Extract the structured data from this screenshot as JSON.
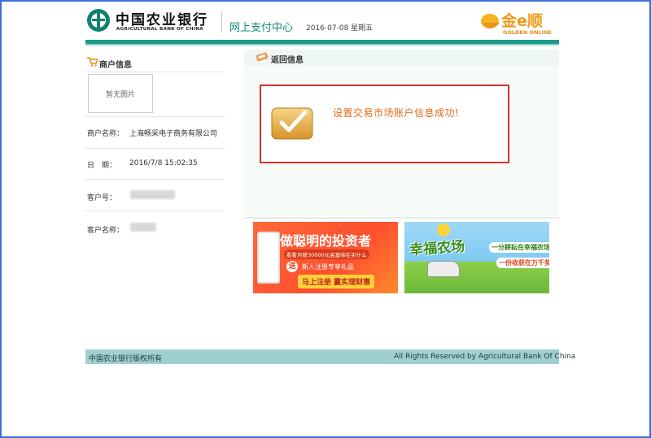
{
  "header": {
    "bank_name_cn": "中国农业银行",
    "bank_name_en": "AGRICULTURAL BANK OF CHINA",
    "center_title": "网上支付中心",
    "date": "2016-07-08 星期五",
    "partner_cn": "金e顺",
    "partner_en": "GOLDEN ONLINE"
  },
  "sidebar": {
    "title": "商户信息",
    "photo_placeholder": "暂无图片",
    "fields": [
      {
        "label": "商户名称：",
        "value": "上海畅采电子商务有限公司"
      },
      {
        "label": "日　期：",
        "value": "2016/7/8 15:02:35"
      },
      {
        "label": "客户号：",
        "value": ""
      },
      {
        "label": "客户名称：",
        "value": ""
      }
    ]
  },
  "result": {
    "title": "返回信息",
    "message": "设置交易市场账户信息成功!"
  },
  "banners": {
    "invest": {
      "title": "做聪明的投资者",
      "subtitle": "看看月薪30000元高富帅在买什么",
      "gift_prefix": "送",
      "gift": "新人注册专享礼品",
      "cta": "马上注册 赢实理财惠"
    },
    "farm": {
      "title": "幸福农场",
      "line1": "一分耕耘在幸福农场",
      "line2": "一份收获在万千奖品"
    }
  },
  "footer": {
    "left": "中国农业银行版权所有",
    "right": "All Rights Reserved by Agricultural Bank Of China"
  },
  "colors": {
    "frame_border": "#3e6fd8",
    "header_bar": "#1a9a88",
    "success_border": "#d9302c",
    "success_text": "#e26b1a",
    "footer_bg": "#9fcfcf"
  }
}
